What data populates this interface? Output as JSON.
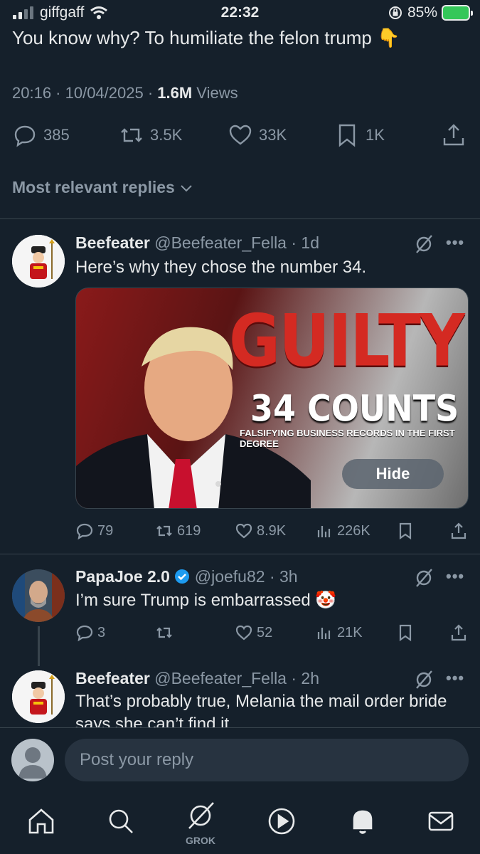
{
  "status_bar": {
    "carrier": "giffgaff",
    "time": "22:32",
    "battery": "85%"
  },
  "tweet": {
    "text": "You know why?  To humiliate the felon trump 👇",
    "time": "20:16 · 10/04/2025 · ",
    "views_count": "1.6M",
    "views_label": " Views",
    "replies": "385",
    "reposts": "3.5K",
    "likes": "33K",
    "bookmarks": "1K"
  },
  "sort_label": "Most relevant replies",
  "replies": [
    {
      "name": "Beefeater",
      "handle": "@Beefeater_Fella · 1d",
      "text": "Here’s why they chose the number 34.",
      "media": {
        "headline": "GUILTY",
        "subhead": "34 COUNTS",
        "caption": "FALSIFYING BUSINESS RECORDS IN THE FIRST DEGREE",
        "hide_label": "Hide"
      },
      "replies": "79",
      "reposts": "619",
      "likes": "8.9K",
      "views": "226K"
    },
    {
      "name": "PapaJoe 2.0",
      "handle": "@joefu82 · 3h",
      "text": "I’m sure Trump is embarrassed 🤡",
      "replies": "3",
      "reposts": "",
      "likes": "52",
      "views": "21K"
    },
    {
      "name": "Beefeater",
      "handle": "@Beefeater_Fella · 2h",
      "text": "That’s probably true, Melania the mail order bride says she can’t find it"
    }
  ],
  "compose": {
    "placeholder": "Post your reply"
  },
  "tabbar": {
    "grok_label": "GROK"
  },
  "colors": {
    "background": "#15202b",
    "muted": "#8b98a5",
    "verified": "#1d9bf0",
    "battery": "#34c759"
  }
}
